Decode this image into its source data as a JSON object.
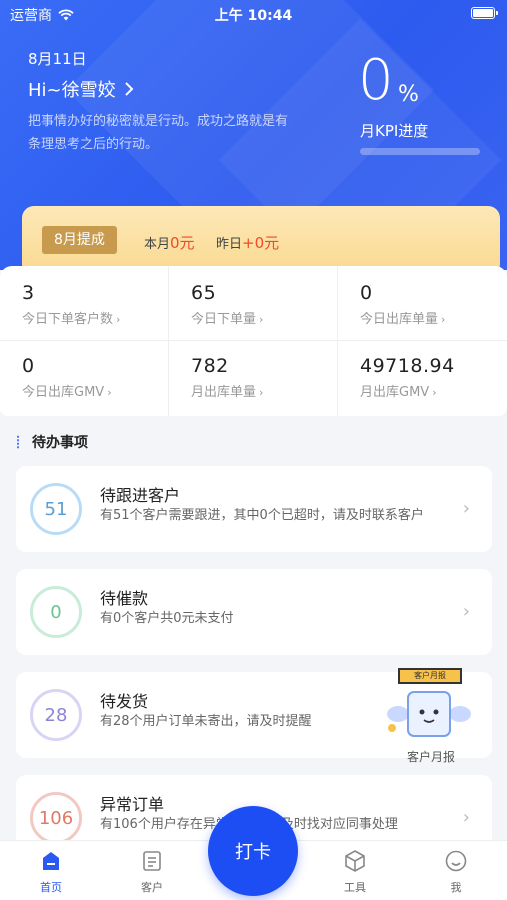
{
  "status_bar": {
    "carrier": "运营商",
    "time": "上午 10:44"
  },
  "header": {
    "date": "8月11日",
    "greeting": "Hi~徐雪姣",
    "motto": "把事情办好的秘密就是行动。成功之路就是有条理思考之后的行动。",
    "kpi_value": "0",
    "kpi_unit": "%",
    "kpi_label": "月KPI进度",
    "kpi_progress": 0
  },
  "commission": {
    "badge": "8月提成",
    "month_label": "本月",
    "month_value": "0元",
    "yesterday_label": "昨日",
    "yesterday_value": "+0元"
  },
  "stats": [
    {
      "value": "3",
      "label": "今日下单客户数"
    },
    {
      "value": "65",
      "label": "今日下单量"
    },
    {
      "value": "0",
      "label": "今日出库单量"
    },
    {
      "value": "0",
      "label": "今日出库GMV"
    },
    {
      "value": "782",
      "label": "月出库单量"
    },
    {
      "value": "49718.94",
      "label": "月出库GMV"
    }
  ],
  "todo": {
    "title": "待办事项",
    "items": [
      {
        "count": "51",
        "title": "待跟进客户",
        "desc": "有51个客户需要跟进，其中0个已超时，请及时联系客户",
        "ring_color": "#b9dcf6",
        "text_color": "#5a9fd4"
      },
      {
        "count": "0",
        "title": "待催款",
        "desc": "有0个客户共0元未支付",
        "ring_color": "#c9ecd8",
        "text_color": "#6cc291"
      },
      {
        "count": "28",
        "title": "待发货",
        "desc": "有28个用户订单未寄出，请及时提醒",
        "ring_color": "#d7d5f4",
        "text_color": "#8a86d6"
      },
      {
        "count": "106",
        "title": "异常订单",
        "desc": "有106个用户存在异常订单，请及时找对应同事处理",
        "ring_color": "#f1c9c2",
        "text_color": "#e07a66"
      }
    ]
  },
  "promo": {
    "sign_text": "客户月报",
    "caption": "客户月报"
  },
  "clock_button": "打卡",
  "tabbar": [
    {
      "label": "首页",
      "icon": "home-icon"
    },
    {
      "label": "客户",
      "icon": "document-icon"
    },
    {
      "label": "工具",
      "icon": "cube-icon"
    },
    {
      "label": "我",
      "icon": "smile-icon"
    }
  ]
}
